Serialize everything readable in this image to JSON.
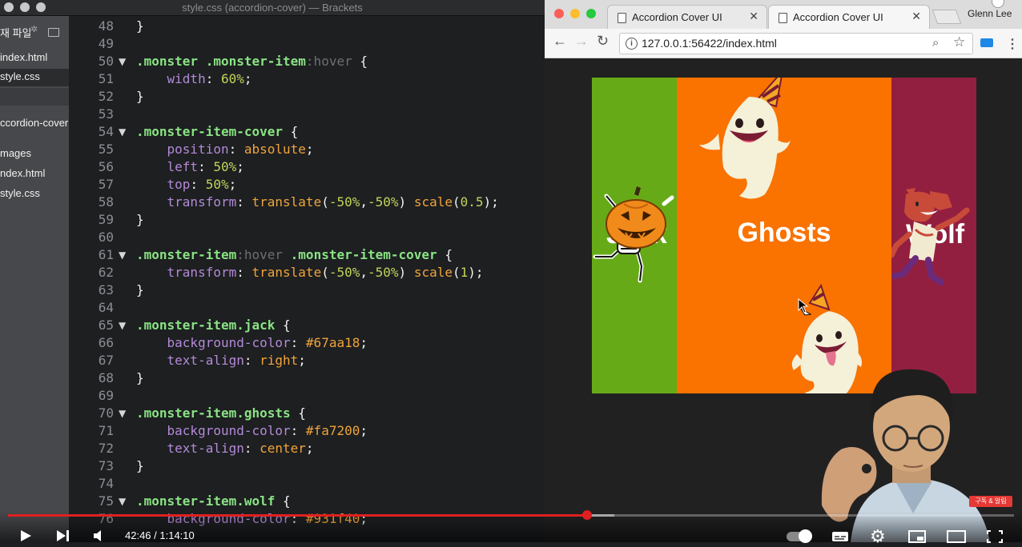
{
  "brackets": {
    "window_title": "style.css (accordion-cover) — Brackets",
    "sidebar": {
      "working_files_label": "재 파일",
      "working_files": [
        "index.html",
        "style.css"
      ],
      "project_name": "ccordion-cover",
      "tree": [
        "mages",
        "ndex.html",
        "style.css"
      ]
    },
    "code": {
      "line_numbers": [
        "48",
        "49",
        "50",
        "51",
        "52",
        "53",
        "54",
        "55",
        "56",
        "57",
        "58",
        "59",
        "60",
        "61",
        "62",
        "63",
        "64",
        "65",
        "66",
        "67",
        "68",
        "69",
        "70",
        "71",
        "72",
        "73",
        "74",
        "75",
        "76"
      ],
      "folds": [
        "50",
        "54",
        "61",
        "65",
        "70",
        "75"
      ],
      "lines": [
        [
          [
            "pun",
            "}"
          ]
        ],
        [],
        [
          [
            "sel",
            ".monster .monster-item"
          ],
          [
            "pse",
            ":hover"
          ],
          [
            "pun",
            " {"
          ]
        ],
        [
          [
            "pun",
            "    "
          ],
          [
            "prop",
            "width"
          ],
          [
            "pun",
            ": "
          ],
          [
            "num",
            "60%"
          ],
          [
            "pun",
            ";"
          ]
        ],
        [
          [
            "pun",
            "}"
          ]
        ],
        [],
        [
          [
            "sel",
            ".monster-item-cover"
          ],
          [
            "pun",
            " {"
          ]
        ],
        [
          [
            "pun",
            "    "
          ],
          [
            "prop",
            "position"
          ],
          [
            "pun",
            ": "
          ],
          [
            "val",
            "absolute"
          ],
          [
            "pun",
            ";"
          ]
        ],
        [
          [
            "pun",
            "    "
          ],
          [
            "prop",
            "left"
          ],
          [
            "pun",
            ": "
          ],
          [
            "num",
            "50%"
          ],
          [
            "pun",
            ";"
          ]
        ],
        [
          [
            "pun",
            "    "
          ],
          [
            "prop",
            "top"
          ],
          [
            "pun",
            ": "
          ],
          [
            "num",
            "50%"
          ],
          [
            "pun",
            ";"
          ]
        ],
        [
          [
            "pun",
            "    "
          ],
          [
            "prop",
            "transform"
          ],
          [
            "pun",
            ": "
          ],
          [
            "val",
            "translate"
          ],
          [
            "pun",
            "("
          ],
          [
            "num",
            "-50%"
          ],
          [
            "pun",
            ","
          ],
          [
            "num",
            "-50%"
          ],
          [
            "pun",
            ") "
          ],
          [
            "val",
            "scale"
          ],
          [
            "pun",
            "("
          ],
          [
            "num",
            "0.5"
          ],
          [
            "pun",
            ");"
          ]
        ],
        [
          [
            "pun",
            "}"
          ]
        ],
        [],
        [
          [
            "sel",
            ".monster-item"
          ],
          [
            "pse",
            ":hover"
          ],
          [
            "sel",
            " .monster-item-cover"
          ],
          [
            "pun",
            " {"
          ]
        ],
        [
          [
            "pun",
            "    "
          ],
          [
            "prop",
            "transform"
          ],
          [
            "pun",
            ": "
          ],
          [
            "val",
            "translate"
          ],
          [
            "pun",
            "("
          ],
          [
            "num",
            "-50%"
          ],
          [
            "pun",
            ","
          ],
          [
            "num",
            "-50%"
          ],
          [
            "pun",
            ") "
          ],
          [
            "val",
            "scale"
          ],
          [
            "pun",
            "("
          ],
          [
            "num",
            "1"
          ],
          [
            "pun",
            ");"
          ]
        ],
        [
          [
            "pun",
            "}"
          ]
        ],
        [],
        [
          [
            "sel",
            ".monster-item.jack"
          ],
          [
            "pun",
            " {"
          ]
        ],
        [
          [
            "pun",
            "    "
          ],
          [
            "prop",
            "background-color"
          ],
          [
            "pun",
            ": "
          ],
          [
            "val",
            "#67aa18"
          ],
          [
            "pun",
            ";"
          ]
        ],
        [
          [
            "pun",
            "    "
          ],
          [
            "prop",
            "text-align"
          ],
          [
            "pun",
            ": "
          ],
          [
            "val",
            "right"
          ],
          [
            "pun",
            ";"
          ]
        ],
        [
          [
            "pun",
            "}"
          ]
        ],
        [],
        [
          [
            "sel",
            ".monster-item.ghosts"
          ],
          [
            "pun",
            " {"
          ]
        ],
        [
          [
            "pun",
            "    "
          ],
          [
            "prop",
            "background-color"
          ],
          [
            "pun",
            ": "
          ],
          [
            "val",
            "#fa7200"
          ],
          [
            "pun",
            ";"
          ]
        ],
        [
          [
            "pun",
            "    "
          ],
          [
            "prop",
            "text-align"
          ],
          [
            "pun",
            ": "
          ],
          [
            "val",
            "center"
          ],
          [
            "pun",
            ";"
          ]
        ],
        [
          [
            "pun",
            "}"
          ]
        ],
        [],
        [
          [
            "sel",
            ".monster-item.wolf"
          ],
          [
            "pun",
            " {"
          ]
        ],
        [
          [
            "pun",
            "    "
          ],
          [
            "prop",
            "background-color"
          ],
          [
            "pun",
            ": "
          ],
          [
            "val",
            "#931f40"
          ],
          [
            "pun",
            ";"
          ]
        ]
      ]
    }
  },
  "chrome": {
    "tabs": [
      {
        "label": "Accordion Cover UI",
        "active": false
      },
      {
        "label": "Accordion Cover UI",
        "active": true
      }
    ],
    "profile_name": "Glenn Lee",
    "url": "127.0.0.1:56422/index.html",
    "page": {
      "panels": [
        {
          "id": "jack",
          "label": "Jack",
          "color": "#67aa18"
        },
        {
          "id": "ghosts",
          "label": "Ghosts",
          "color": "#fa7200"
        },
        {
          "id": "wolf",
          "label": "Wolf",
          "color": "#931f40"
        }
      ]
    }
  },
  "player": {
    "timecode": "42:46 / 1:14:10",
    "progress": 0.576,
    "buffered": 0.603,
    "subscribe_badge": "구독 & 알림"
  }
}
